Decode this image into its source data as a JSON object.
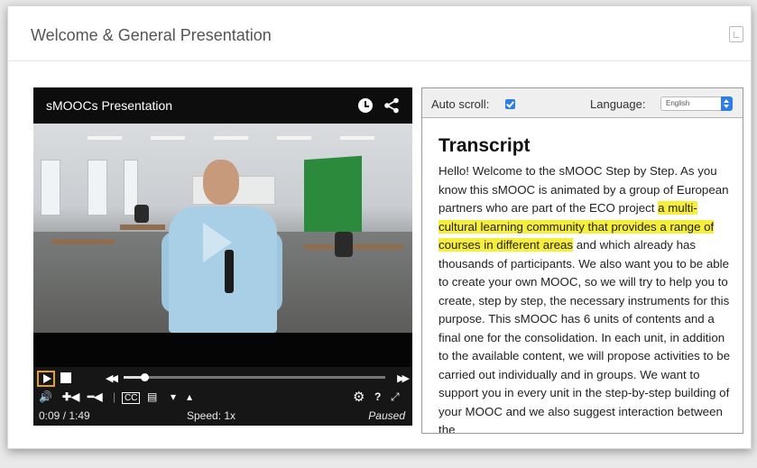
{
  "card": {
    "title": "Welcome & General Presentation"
  },
  "player": {
    "title": "sMOOCs Presentation",
    "time": "0:09 / 1:49",
    "speed": "Speed: 1x",
    "status": "Paused",
    "progress": 0.08,
    "icons": [
      "clock-icon",
      "share-icon",
      "play-icon",
      "stop-icon",
      "rewind-icon",
      "fast-forward-icon",
      "volume-icon",
      "slower-icon",
      "faster-icon",
      "subtitles-icon",
      "transcript-icon",
      "caret-down-icon",
      "caret-up-icon",
      "settings-icon",
      "help-icon",
      "fullscreen-icon"
    ]
  },
  "transcript": {
    "autoscroll_label": "Auto scroll:",
    "autoscroll_checked": true,
    "language_label": "Language:",
    "language_value": "English",
    "heading": "Transcript",
    "text_before": "Hello! Welcome to the sMOOC Step by Step. As you know this sMOOC is animated by a group of European partners who are part of the ECO project ",
    "text_highlight": "a multi-cultural learning community that provides a range of courses in different areas",
    "text_after": " and which already has thousands of participants. We also want you to be able to create your own MOOC, so we will try to help you to create, step by step, the necessary instruments for this purpose. This sMOOC has 6 units of contents and a final one for the consolidation. In each unit, in addition to the available content, we will propose activities to be carried out individually and in groups. We want to support you in every unit in the step-by-step building of your MOOC and we also suggest interaction between the",
    "highlight_color": "#f6ee3a"
  }
}
